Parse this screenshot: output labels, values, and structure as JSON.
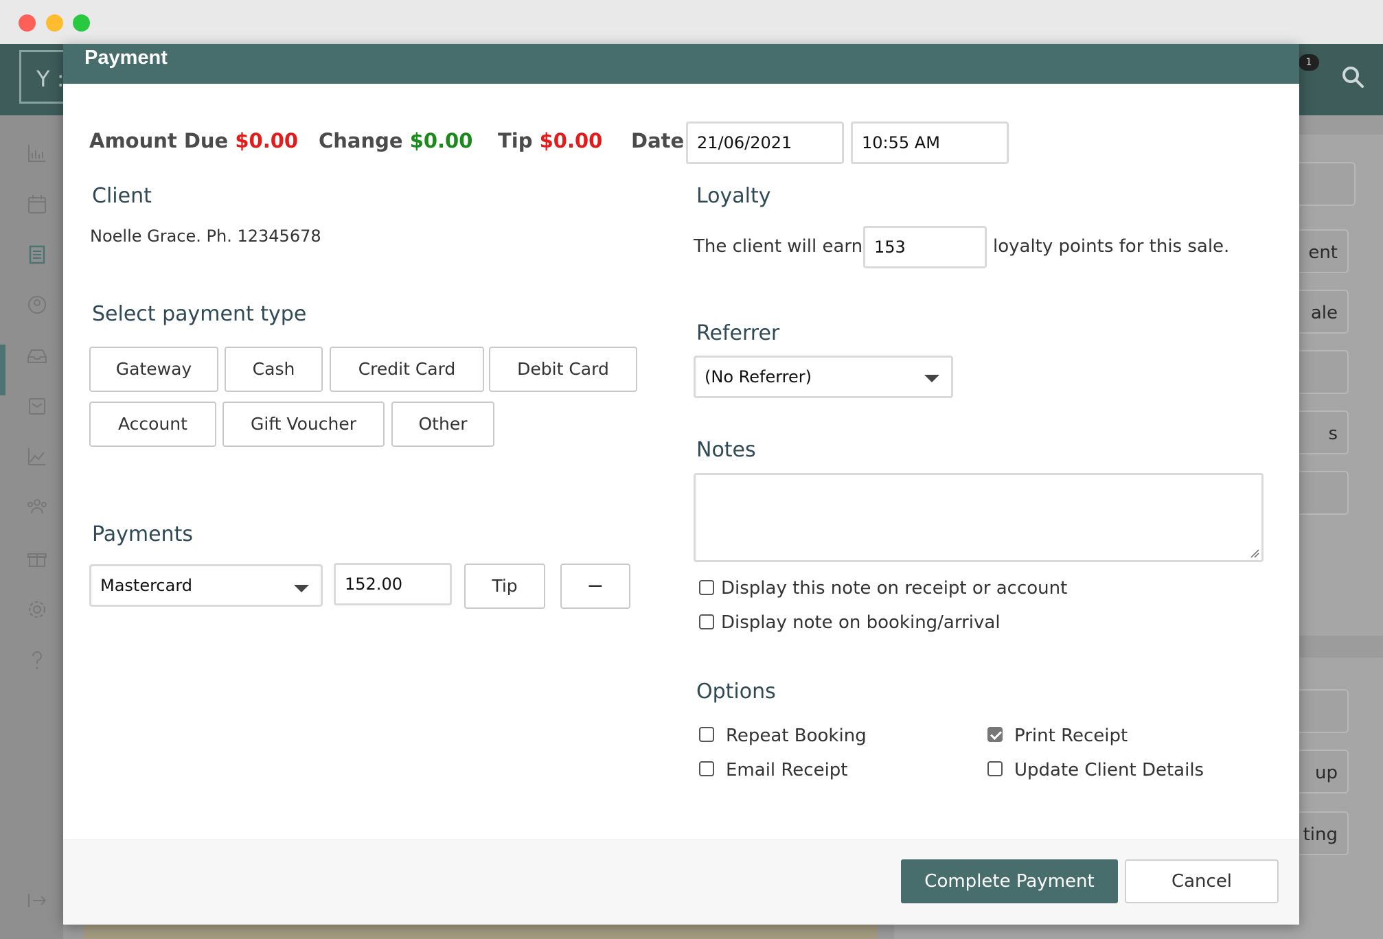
{
  "window": {
    "title_controls": [
      "close",
      "minimize",
      "maximize"
    ]
  },
  "background_app": {
    "logo_text": "Y :",
    "notification_count": "1",
    "right_buttons": [
      "ent",
      "ale",
      "",
      "s",
      "",
      "",
      "up",
      "ting"
    ]
  },
  "modal": {
    "title": "Payment",
    "summary": {
      "amount_due_label": "Amount Due",
      "amount_due_value": "$0.00",
      "change_label": "Change",
      "change_value": "$0.00",
      "tip_label": "Tip",
      "tip_value": "$0.00",
      "date_label": "Date",
      "date_value": "21/06/2021",
      "time_value": "10:55 AM"
    },
    "client": {
      "title": "Client",
      "info": "Noelle Grace. Ph. 12345678"
    },
    "loyalty": {
      "title": "Loyalty",
      "prefix": "The client will earn",
      "points": "153",
      "suffix": "loyalty points for this sale."
    },
    "payment_type": {
      "title": "Select payment type",
      "buttons": [
        "Gateway",
        "Cash",
        "Credit Card",
        "Debit Card",
        "Account",
        "Gift Voucher",
        "Other"
      ]
    },
    "referrer": {
      "title": "Referrer",
      "selected": "(No Referrer)"
    },
    "notes": {
      "title": "Notes",
      "value": "",
      "checkbox_receipt": "Display this note on receipt or account",
      "checkbox_booking": "Display note on booking/arrival",
      "receipt_checked": false,
      "booking_checked": false
    },
    "payments": {
      "title": "Payments",
      "method": "Mastercard",
      "amount": "152.00",
      "tip_button": "Tip",
      "remove_button": "−"
    },
    "options": {
      "title": "Options",
      "repeat_booking": "Repeat Booking",
      "email_receipt": "Email Receipt",
      "print_receipt": "Print Receipt",
      "update_client": "Update Client Details",
      "repeat_checked": false,
      "email_checked": false,
      "print_checked": true,
      "update_checked": false
    },
    "footer": {
      "complete": "Complete Payment",
      "cancel": "Cancel"
    }
  },
  "colors": {
    "header": "#476e6c",
    "amount_red": "#e31b1b",
    "change_green": "#1a8a1a"
  }
}
